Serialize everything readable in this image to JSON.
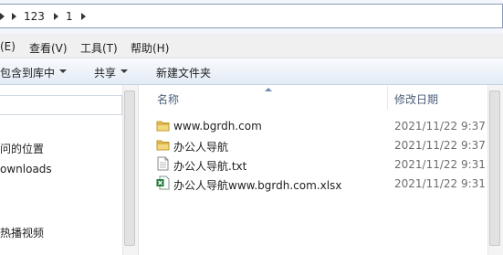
{
  "address": {
    "crumbs": [
      "123",
      "1"
    ]
  },
  "menu": {
    "items": [
      "(E)",
      "查看(V)",
      "工具(T)",
      "帮助(H)"
    ]
  },
  "toolbar": {
    "include_library": "包含到库中",
    "share": "共享",
    "new_folder": "新建文件夹"
  },
  "nav": {
    "items": [
      "问的位置",
      "ownloads",
      "热播视频"
    ]
  },
  "list": {
    "columns": {
      "name": "名称",
      "modified": "修改日期"
    },
    "files": [
      {
        "name": "www.bgrdh.com",
        "modified": "2021/11/22 9:37",
        "icon": "folder-icon"
      },
      {
        "name": "办公人导航",
        "modified": "2021/11/22 9:37",
        "icon": "folder-icon"
      },
      {
        "name": "办公人导航.txt",
        "modified": "2021/11/22 9:31",
        "icon": "text-file-icon"
      },
      {
        "name": "办公人导航www.bgrdh.com.xlsx",
        "modified": "2021/11/22 9:31",
        "icon": "excel-file-icon"
      }
    ]
  },
  "colors": {
    "folder": "#e8c15a",
    "excel": "#1f7a3a",
    "header_text": "#4c607a"
  }
}
